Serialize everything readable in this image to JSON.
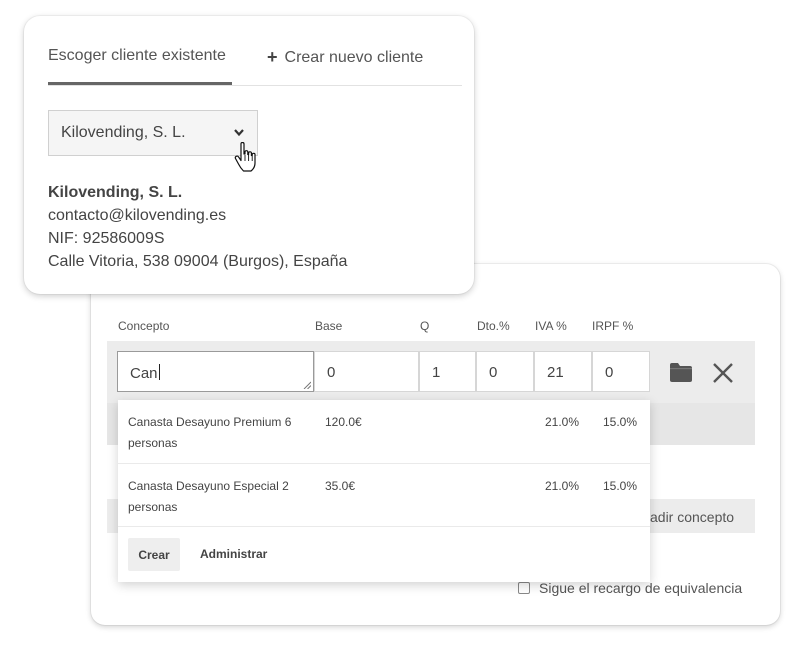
{
  "client_panel": {
    "tab_existing": "Escoger cliente existente",
    "tab_new": "Crear nuevo cliente",
    "selected_client": "Kilovending, S. L.",
    "client": {
      "name": "Kilovending, S. L.",
      "email": "contacto@kilovending.es",
      "nif": "NIF: 92586009S",
      "address": "Calle Vitoria, 538 09004 (Burgos), España"
    }
  },
  "lines_panel": {
    "columns": {
      "concept": "Concepto",
      "base": "Base",
      "qty": "Q",
      "discount": "Dto.%",
      "iva": "IVA %",
      "irpf": "IRPF %"
    },
    "row": {
      "concept": "Can",
      "base": "0",
      "qty": "1",
      "discount": "0",
      "iva": "21",
      "irpf": "0"
    },
    "add_concept": "adir concepto",
    "surcharge_label": "Sigue el recargo de equivalencia"
  },
  "suggestions": {
    "items": [
      {
        "name": "Canasta Desayuno Premium 6 personas",
        "price": "120.0€",
        "iva": "21.0%",
        "irpf": "15.0%"
      },
      {
        "name": "Canasta Desayuno Especial 2 personas",
        "price": "35.0€",
        "iva": "21.0%",
        "irpf": "15.0%"
      }
    ],
    "create_label": "Crear",
    "admin_label": "Administrar"
  },
  "icons": {
    "folder": "folder-icon",
    "close": "close-icon",
    "plus": "plus-icon",
    "chevron": "chevron-down-icon",
    "cursor": "hand-cursor-icon"
  }
}
